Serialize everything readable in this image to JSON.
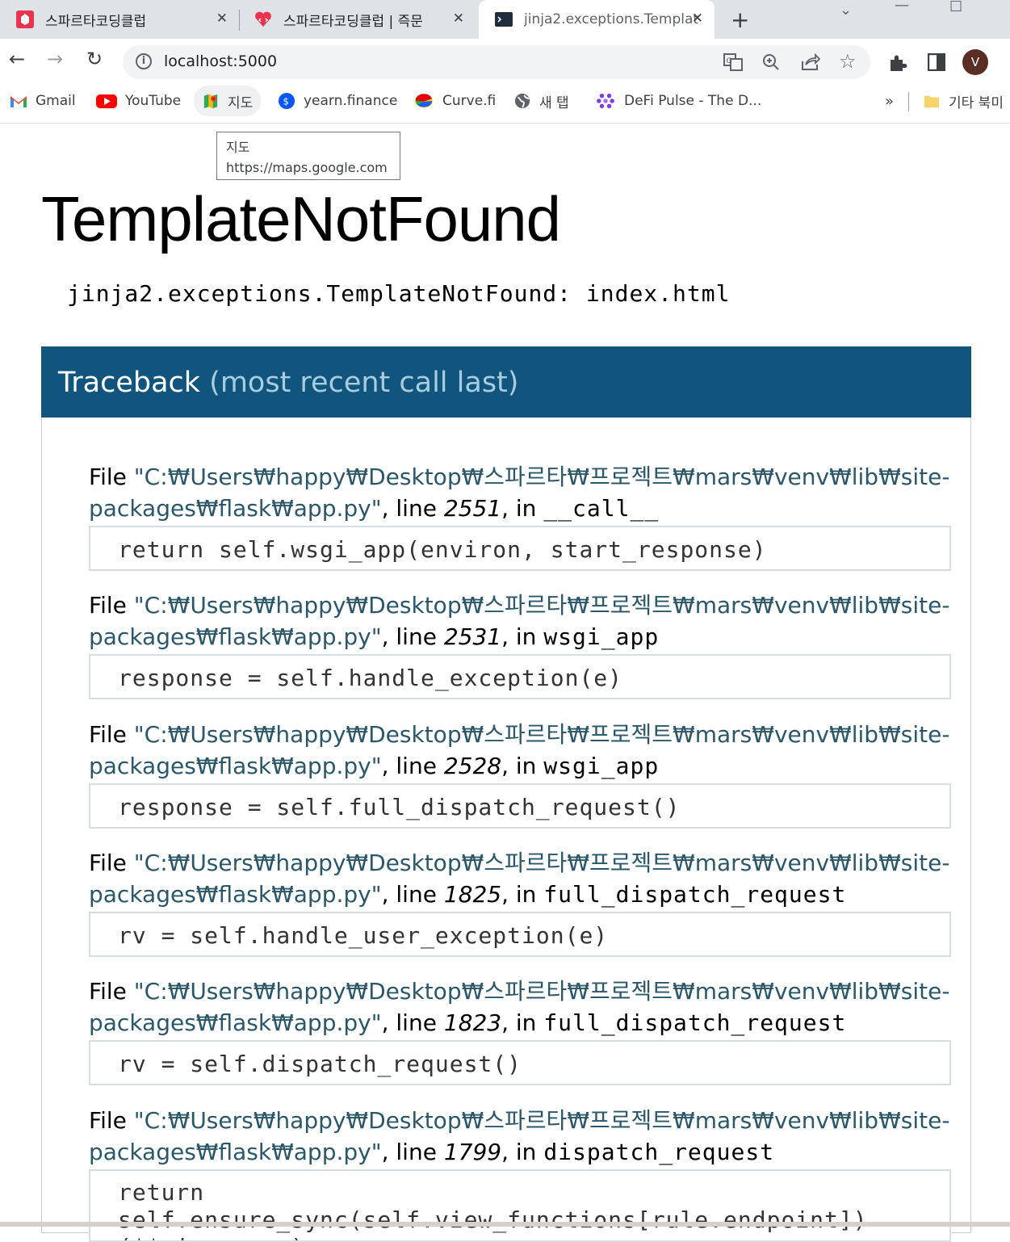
{
  "browser": {
    "tabs": [
      {
        "title": "스파르타코딩클럽",
        "icon": "spartacodingclub-icon",
        "active": false
      },
      {
        "title": "스파르타코딩클럽 | 즉문",
        "icon": "spartacodingclub-heart-icon",
        "active": false
      },
      {
        "title": "jinja2.exceptions.Templat",
        "icon": "terminal-icon",
        "active": true
      }
    ],
    "tab_close": "✕",
    "new_tab": "+",
    "url": "localhost:5000",
    "bookmarks": [
      {
        "label": "Gmail",
        "icon": "gmail-icon"
      },
      {
        "label": "YouTube",
        "icon": "youtube-icon"
      },
      {
        "label": "지도",
        "icon": "maps-icon"
      },
      {
        "label": "yearn.finance",
        "icon": "yearn-icon"
      },
      {
        "label": "Curve.fi",
        "icon": "curve-icon"
      },
      {
        "label": "새 탭",
        "icon": "globe-icon"
      },
      {
        "label": "DeFi Pulse - The D...",
        "icon": "defipulse-icon"
      }
    ],
    "bookmarks_more": "»",
    "other_bookmarks": "기타 북미",
    "avatar_initial": "V",
    "tooltip": {
      "title": "지도",
      "url": "https://maps.google.com"
    }
  },
  "page": {
    "title": "TemplateNotFound",
    "error_message": "jinja2.exceptions.TemplateNotFound: index.html",
    "traceback_label": "Traceback",
    "traceback_sub": "(most recent call last)",
    "frames": [
      {
        "file_prefix": "File ",
        "path_line1": "\"C:₩Users₩happy₩Desktop₩스파르타₩프로젝트₩mars₩venv₩lib₩site-",
        "path_line2": "packages₩flask₩app.py\"",
        "line_word": ", line ",
        "line_no": "2551",
        "in_word": ", in ",
        "func": "__call__",
        "source": "return self.wsgi_app(environ, start_response)"
      },
      {
        "file_prefix": "File ",
        "path_line1": "\"C:₩Users₩happy₩Desktop₩스파르타₩프로젝트₩mars₩venv₩lib₩site-",
        "path_line2": "packages₩flask₩app.py\"",
        "line_word": ", line ",
        "line_no": "2531",
        "in_word": ", in ",
        "func": "wsgi_app",
        "source": "response = self.handle_exception(e)"
      },
      {
        "file_prefix": "File ",
        "path_line1": "\"C:₩Users₩happy₩Desktop₩스파르타₩프로젝트₩mars₩venv₩lib₩site-",
        "path_line2": "packages₩flask₩app.py\"",
        "line_word": ", line ",
        "line_no": "2528",
        "in_word": ", in ",
        "func": "wsgi_app",
        "source": "response = self.full_dispatch_request()"
      },
      {
        "file_prefix": "File ",
        "path_line1": "\"C:₩Users₩happy₩Desktop₩스파르타₩프로젝트₩mars₩venv₩lib₩site-",
        "path_line2": "packages₩flask₩app.py\"",
        "line_word": ", line ",
        "line_no": "1825",
        "in_word": ", in ",
        "func": "full_dispatch_request",
        "source": "rv = self.handle_user_exception(e)"
      },
      {
        "file_prefix": "File ",
        "path_line1": "\"C:₩Users₩happy₩Desktop₩스파르타₩프로젝트₩mars₩venv₩lib₩site-",
        "path_line2": "packages₩flask₩app.py\"",
        "line_word": ", line ",
        "line_no": "1823",
        "in_word": ", in ",
        "func": "full_dispatch_request",
        "source": "rv = self.dispatch_request()"
      },
      {
        "file_prefix": "File ",
        "path_line1": "\"C:₩Users₩happy₩Desktop₩스파르타₩프로젝트₩mars₩venv₩lib₩site-",
        "path_line2": "packages₩flask₩app.py\"",
        "line_word": ", line ",
        "line_no": "1799",
        "in_word": ", in ",
        "func": "dispatch_request",
        "source": "return self.ensure_sync(self.view_functions[rule.endpoint])(**view_args)"
      }
    ]
  },
  "colors": {
    "traceback_header": "#11557c",
    "path_text": "#2b5768"
  }
}
